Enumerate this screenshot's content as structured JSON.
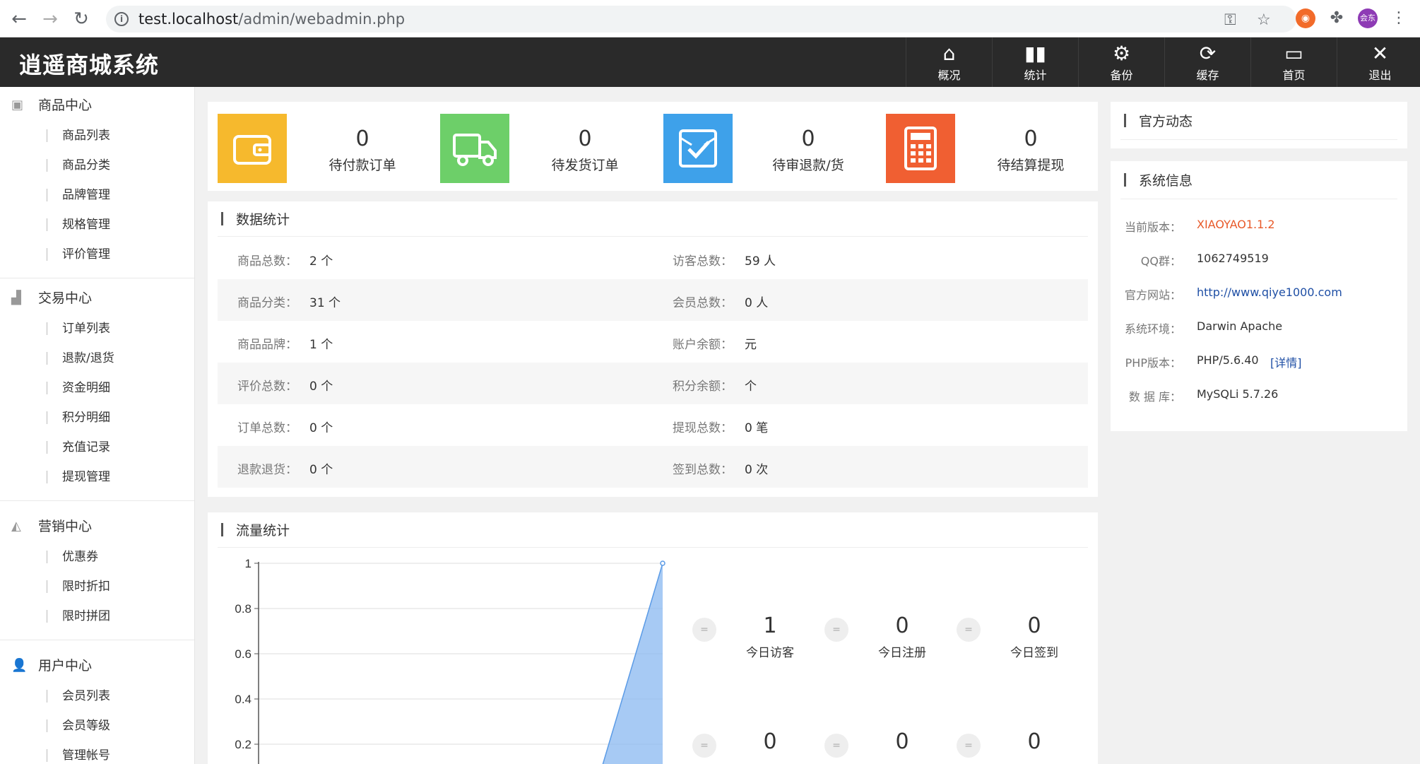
{
  "browser": {
    "url_host": "test.localhost",
    "url_path": "/admin/webadmin.php",
    "profile_label": "会东"
  },
  "header": {
    "title": "逍遥商城系统",
    "nav": [
      {
        "label": "概况",
        "icon": "home-icon"
      },
      {
        "label": "统计",
        "icon": "bar-chart-icon"
      },
      {
        "label": "备份",
        "icon": "gear-icon"
      },
      {
        "label": "缓存",
        "icon": "refresh-icon"
      },
      {
        "label": "首页",
        "icon": "monitor-icon"
      },
      {
        "label": "退出",
        "icon": "close-icon"
      }
    ]
  },
  "sidebar": {
    "groups": [
      {
        "title": "商品中心",
        "icon": "goods-icon",
        "items": [
          "商品列表",
          "商品分类",
          "品牌管理",
          "规格管理",
          "评价管理"
        ]
      },
      {
        "title": "交易中心",
        "icon": "bar-chart-icon",
        "items": [
          "订单列表",
          "退款/退货",
          "资金明细",
          "积分明细",
          "充值记录",
          "提现管理"
        ]
      },
      {
        "title": "营销中心",
        "icon": "area-chart-icon",
        "items": [
          "优惠券",
          "限时折扣",
          "限时拼团"
        ]
      },
      {
        "title": "用户中心",
        "icon": "user-icon",
        "items": [
          "会员列表",
          "会员等级",
          "管理帐号"
        ]
      }
    ]
  },
  "counters": [
    {
      "value": "0",
      "label": "待付款订单",
      "color": "#f6b92d",
      "icon": "wallet-icon"
    },
    {
      "value": "0",
      "label": "待发货订单",
      "color": "#6dcf69",
      "icon": "truck-icon"
    },
    {
      "value": "0",
      "label": "待审退款/货",
      "color": "#3ea1ea",
      "icon": "checkbox-icon"
    },
    {
      "value": "0",
      "label": "待结算提现",
      "color": "#f05f32",
      "icon": "calculator-icon"
    }
  ],
  "data_stats": {
    "title": "数据统计",
    "rows": [
      {
        "lk": "商品总数：",
        "lv": "2 个",
        "rk": "访客总数：",
        "rv": "59 人"
      },
      {
        "lk": "商品分类：",
        "lv": "31 个",
        "rk": "会员总数：",
        "rv": "0 人"
      },
      {
        "lk": "商品品牌：",
        "lv": "1 个",
        "rk": "账户余额：",
        "rv": "元"
      },
      {
        "lk": "评价总数：",
        "lv": "0 个",
        "rk": "积分余额：",
        "rv": "个"
      },
      {
        "lk": "订单总数：",
        "lv": "0 个",
        "rk": "提现总数：",
        "rv": "0 笔"
      },
      {
        "lk": "退款退货：",
        "lv": "0 个",
        "rk": "签到总数：",
        "rv": "0 次"
      }
    ]
  },
  "traffic": {
    "title": "流量统计",
    "stats": [
      {
        "value": "1",
        "label": "今日访客"
      },
      {
        "value": "0",
        "label": "今日注册"
      },
      {
        "value": "0",
        "label": "今日签到"
      },
      {
        "value": "0",
        "label": ""
      },
      {
        "value": "0",
        "label": ""
      },
      {
        "value": "0",
        "label": ""
      }
    ]
  },
  "chart_data": {
    "type": "area",
    "y_ticks": [
      "1",
      "0.8",
      "0.6",
      "0.4",
      "0.2"
    ],
    "ylim": [
      0,
      1
    ],
    "series": [
      {
        "values": [
          0,
          0,
          0,
          0,
          0,
          0,
          1
        ]
      }
    ],
    "color": "#8ab8f0"
  },
  "news": {
    "title": "官方动态"
  },
  "sysinfo": {
    "title": "系统信息",
    "rows": [
      {
        "k": "当前版本：",
        "v": "XIAOYAO1.1.2",
        "color": "#e85a2a"
      },
      {
        "k": "QQ群：",
        "v": "1062749519",
        "color": "#333333"
      },
      {
        "k": "官方网站：",
        "v": "http://www.qiye1000.com",
        "color": "#1f4fa5"
      },
      {
        "k": "系统环境：",
        "v": "Darwin Apache",
        "color": "#333333"
      },
      {
        "k": "PHP版本：",
        "v": "PHP/5.6.40",
        "extra": "[详情]",
        "color": "#333333"
      },
      {
        "k": "数 据 库：",
        "v": "MySQLi 5.7.26",
        "color": "#333333"
      }
    ]
  }
}
